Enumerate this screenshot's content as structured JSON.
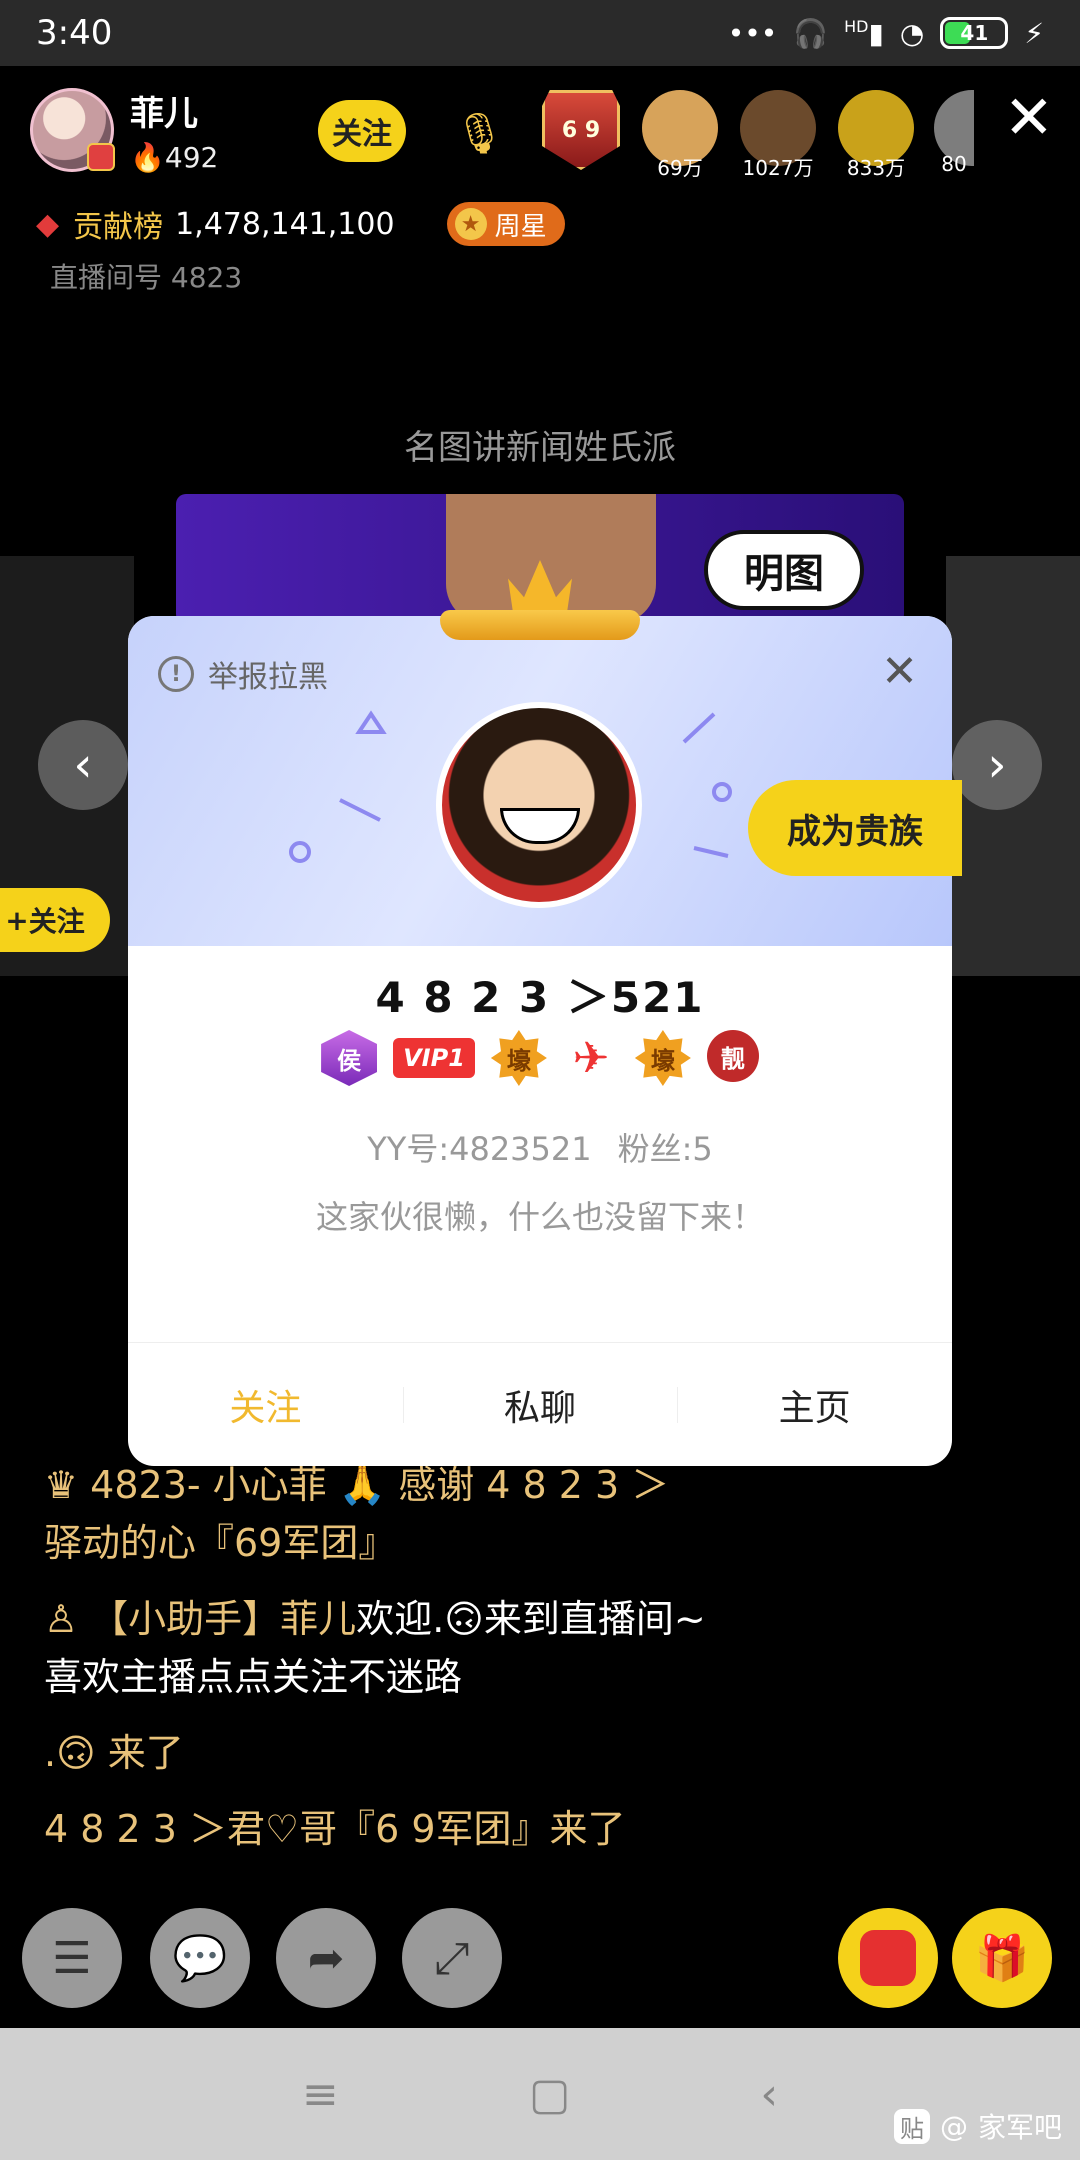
{
  "status_bar": {
    "time": "3:40",
    "signal_label": "HD",
    "battery": "41"
  },
  "anchor": {
    "name": "菲儿",
    "fans": "492",
    "follow_label": "关注"
  },
  "top_viewers": [
    {
      "count": "69万",
      "color": "#d7a35a"
    },
    {
      "count": "1027万",
      "color": "#6b4a2c"
    },
    {
      "count": "833万",
      "color": "#c9a21a"
    },
    {
      "count": "80",
      "color": "#7d7d7d"
    }
  ],
  "rank_badge": "6 9",
  "contribution": {
    "label": "贡献榜",
    "value": "1,478,141,100",
    "weekstar": "周星"
  },
  "room_id": {
    "label": "直播间号",
    "value": "4823"
  },
  "stage_subtitle": "名图讲新闻姓氏派",
  "banner_text": "明图",
  "side_follow": "关注",
  "profile_card": {
    "report_label": "举报拉黑",
    "noble_button": "成为贵族",
    "name": "4 8 2 3 ＞521",
    "badges": [
      {
        "type": "hou",
        "text": "侯"
      },
      {
        "type": "vip",
        "text": "VIP1"
      },
      {
        "type": "hao",
        "text": "壕"
      },
      {
        "type": "plane",
        "text": "✈"
      },
      {
        "type": "hao",
        "text": "壕"
      },
      {
        "type": "jing",
        "text": "靓"
      }
    ],
    "yy_id": "YY号:4823521",
    "fans": "粉丝:5",
    "bio": "这家伙很懒，什么也没留下来！",
    "actions": {
      "follow": "关注",
      "chat": "私聊",
      "home": "主页"
    }
  },
  "chat": {
    "m1_name": "4823- 小心菲",
    "m1_text": "感谢 4 8 2 3 ＞",
    "m1_text2": "驿动的心『69军团』",
    "m2_prefix": "【小助手】菲儿",
    "m2_text": "欢迎.🙃来到直播间~",
    "m2_text2": "喜欢主播点点关注不迷路",
    "m3_text": ".🙃 来了",
    "m4_text": "4 8 2 3 ＞君♡哥『6 9军团』来了"
  },
  "watermark": {
    "text": "家军吧",
    "at": "@"
  }
}
